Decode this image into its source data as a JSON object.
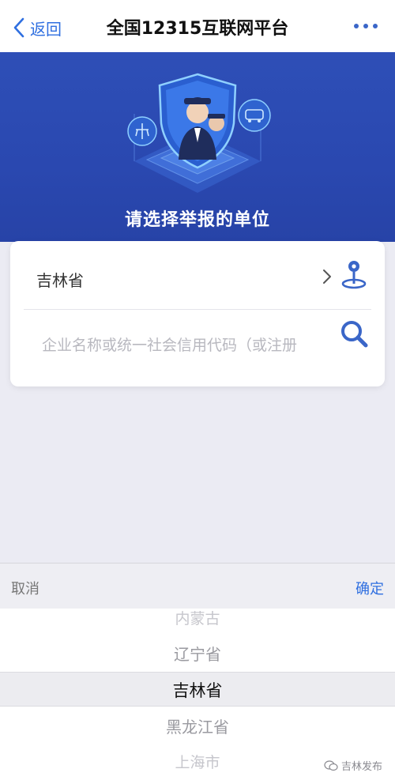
{
  "navbar": {
    "back_label": "返回",
    "title": "全国12315互联网平台"
  },
  "banner": {
    "title": "请选择举报的单位"
  },
  "form": {
    "region_value": "吉林省",
    "search_placeholder": "企业名称或统一社会信用代码（或注册"
  },
  "picker": {
    "cancel_label": "取消",
    "confirm_label": "确定",
    "options": [
      "内蒙古",
      "辽宁省",
      "吉林省",
      "黑龙江省",
      "上海市"
    ],
    "selected_index": 2
  },
  "watermark": {
    "text": "吉林发布"
  },
  "colors": {
    "accent": "#2f6fe0",
    "banner": "#2e4fb7"
  }
}
